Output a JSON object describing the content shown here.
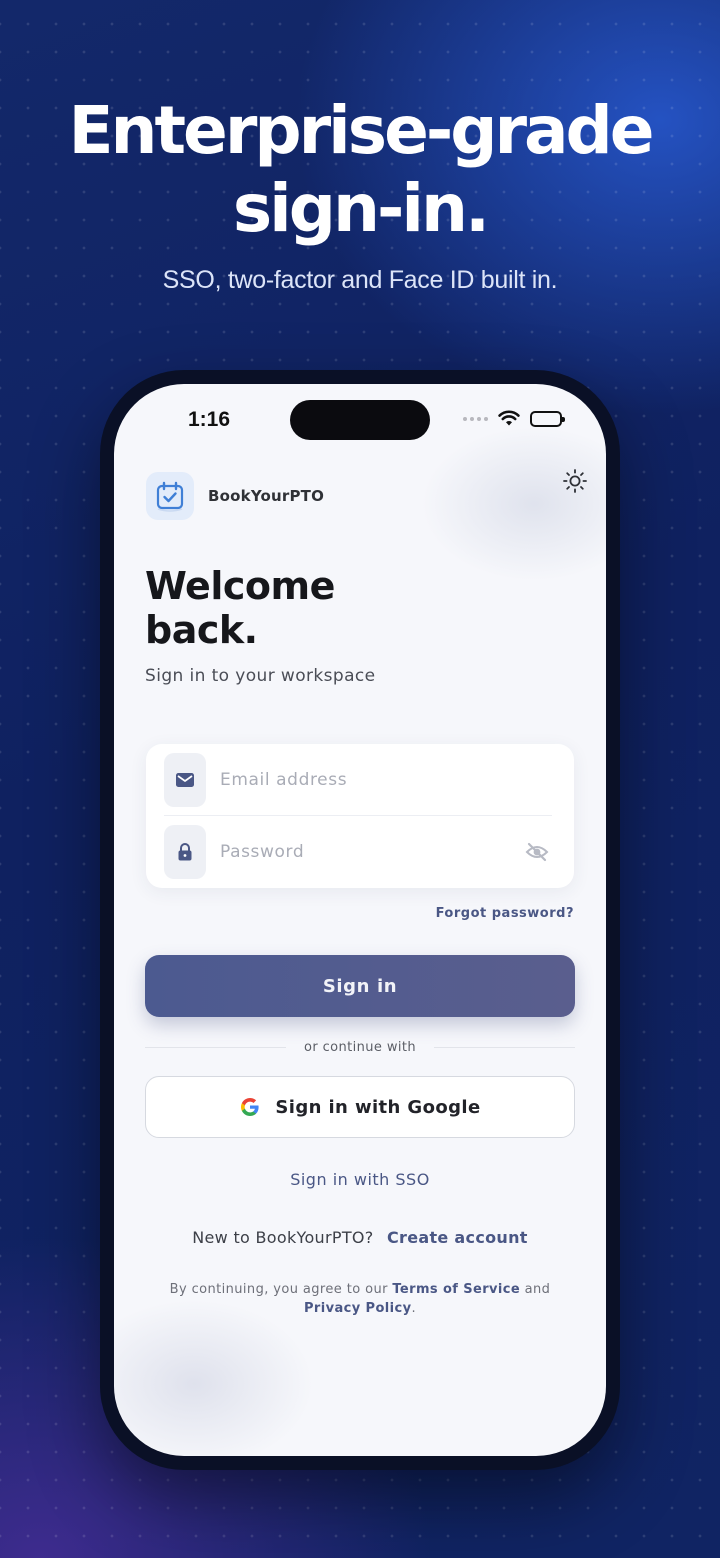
{
  "hero": {
    "title_line1": "Enterprise-grade",
    "title_line2": "sign-in.",
    "subtitle": "SSO, two-factor and Face ID built in."
  },
  "status_bar": {
    "time": "1:16"
  },
  "brand": {
    "name": "BookYourPTO",
    "logo_icon": "calendar-check-icon"
  },
  "welcome": {
    "title_line1": "Welcome",
    "title_line2": "back.",
    "subtitle": "Sign in to your workspace"
  },
  "form": {
    "email_placeholder": "Email address",
    "email_value": "",
    "email_icon": "mail-icon",
    "password_placeholder": "Password",
    "password_value": "",
    "password_icon": "lock-icon",
    "visibility_icon": "eye-off-icon",
    "forgot_label": "Forgot password?"
  },
  "actions": {
    "signin_label": "Sign in",
    "divider_label": "or continue with",
    "google_label": "Sign in with Google",
    "sso_label": "Sign in with SSO"
  },
  "footer": {
    "new_prompt": "New to BookYourPTO?",
    "create_label": "Create account",
    "legal_prefix": "By continuing, you agree to our",
    "terms_label": "Terms of Service",
    "legal_and": "and",
    "privacy_label": "Privacy Policy",
    "legal_suffix": "."
  },
  "colors": {
    "accent": "#4a5785",
    "background_dark": "#10245e",
    "screen_bg": "#f6f7fb"
  }
}
